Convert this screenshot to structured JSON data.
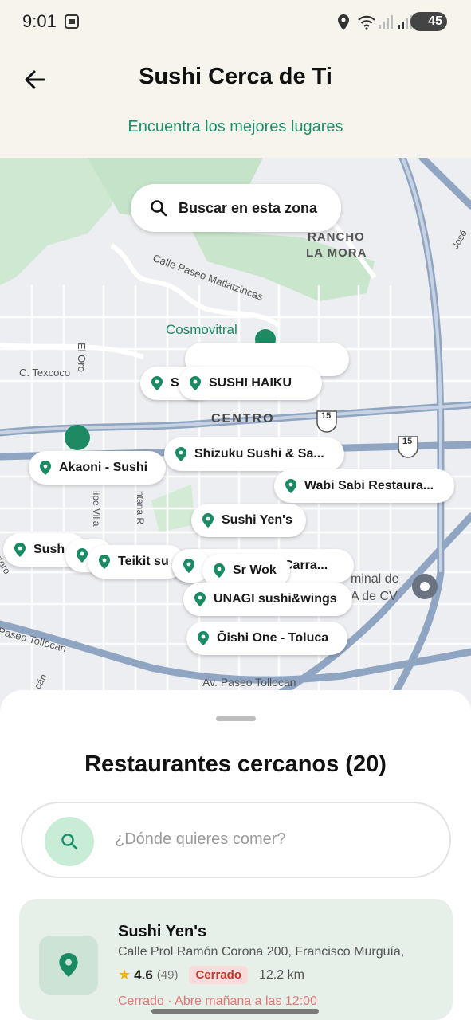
{
  "status_bar": {
    "time": "9:01",
    "battery": "45"
  },
  "header": {
    "title": "Sushi Cerca de Ti",
    "subtitle": "Encuentra los mejores lugares"
  },
  "map": {
    "search_zone_label": "Buscar en esta zona",
    "labels": [
      "RANCHO",
      "LA MORA",
      "Calle Paseo Matlatzincas",
      "Cosmovitral",
      "C. Texcoco",
      "El Oro",
      "CENTRO",
      "15",
      "15",
      "Paseo Tollocan",
      "Av. Paseo Tollocan",
      "minal de",
      "A de CV",
      "José",
      "lipe Villa",
      "ntana R",
      "errero",
      "cán"
    ],
    "pins": [
      {
        "label": "S"
      },
      {
        "label": "SUSHI HAIKU"
      },
      {
        "label": "Shizuku Sushi & Sa..."
      },
      {
        "label": "Akaoni - Sushi"
      },
      {
        "label": "Wabi Sabi Restaura..."
      },
      {
        "label": "Sushi Yen's"
      },
      {
        "label": "Sush"
      },
      {
        "label": "Teikit su"
      },
      {
        "label": "Carra..."
      },
      {
        "label": "Sr Wok"
      },
      {
        "label": "UNAGI sushi&wings"
      },
      {
        "label": "Ōishi One - Toluca"
      }
    ]
  },
  "sheet": {
    "title": "Restaurantes cercanos (20)",
    "search_placeholder": "¿Dónde quieres comer?",
    "card": {
      "name": "Sushi Yen's",
      "address": "Calle Prol Ramón Corona 200, Francisco Murguía,",
      "rating": "4.6",
      "reviews": "(49)",
      "badge": "Cerrado",
      "distance": "12.2 km",
      "status": "Cerrado · Abre mañana a las 12:00"
    }
  },
  "colors": {
    "accent": "#1d8f6d",
    "pin": "#1a8a63",
    "closed": "#c0392b"
  }
}
